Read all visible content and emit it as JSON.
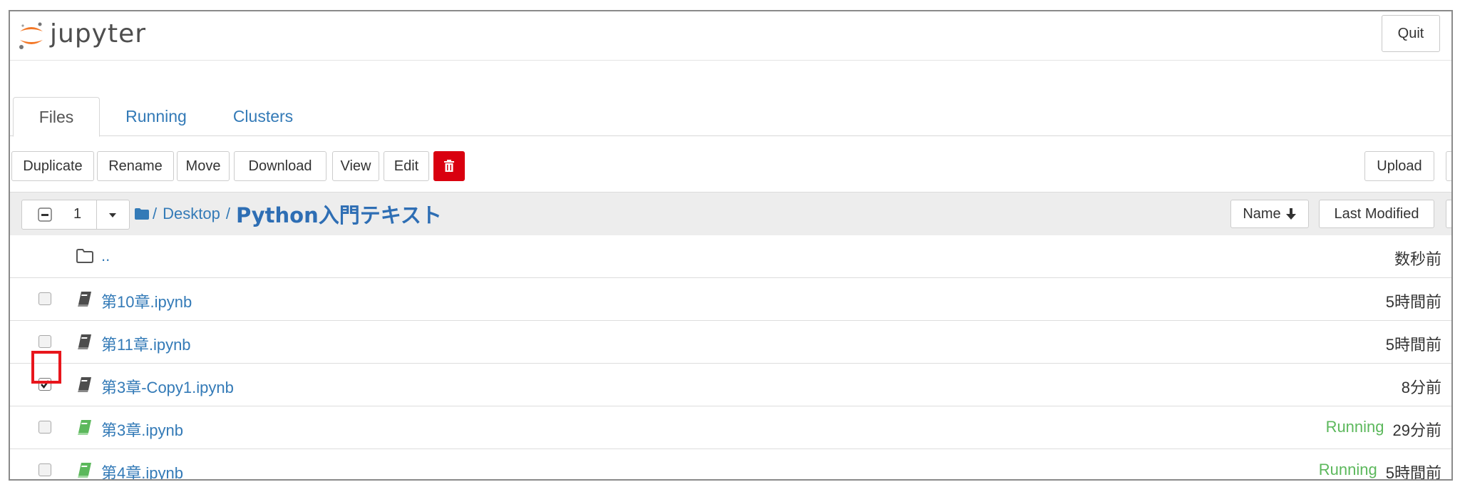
{
  "header": {
    "logo_text": "jupyter",
    "quit_label": "Quit"
  },
  "tabs": [
    {
      "label": "Files",
      "active": true
    },
    {
      "label": "Running",
      "active": false
    },
    {
      "label": "Clusters",
      "active": false
    }
  ],
  "toolbar": {
    "buttons": [
      "Duplicate",
      "Rename",
      "Move",
      "Download",
      "View",
      "Edit"
    ],
    "delete_icon": "trash-icon",
    "upload_label": "Upload"
  },
  "list_header": {
    "selected_count": "1",
    "breadcrumb": {
      "root_sep": "/",
      "folder": "Desktop",
      "sep": "/",
      "current": "Python入門テキスト"
    },
    "sort_name_label": "Name",
    "sort_modified_label": "Last Modified"
  },
  "rows": [
    {
      "type": "parent",
      "name": "..",
      "status": "",
      "modified": "数秒前",
      "checked": false
    },
    {
      "type": "notebook",
      "name": "第10章.ipynb",
      "status": "",
      "modified": "5時間前",
      "checked": false,
      "running": false
    },
    {
      "type": "notebook",
      "name": "第11章.ipynb",
      "status": "",
      "modified": "5時間前",
      "checked": false,
      "running": false
    },
    {
      "type": "notebook",
      "name": "第3章-Copy1.ipynb",
      "status": "",
      "modified": "8分前",
      "checked": true,
      "running": false
    },
    {
      "type": "notebook",
      "name": "第3章.ipynb",
      "status": "Running",
      "modified": "29分前",
      "checked": false,
      "running": true
    },
    {
      "type": "notebook",
      "name": "第4章.ipynb",
      "status": "Running",
      "modified": "5時間前",
      "checked": false,
      "running": true
    }
  ],
  "colors": {
    "link": "#337ab7",
    "running": "#5cb85c",
    "delete_button": "#d9000f",
    "highlight": "#e8161c",
    "notebook_icon_idle": "#4d4d4d",
    "notebook_icon_running": "#5cb85c"
  }
}
